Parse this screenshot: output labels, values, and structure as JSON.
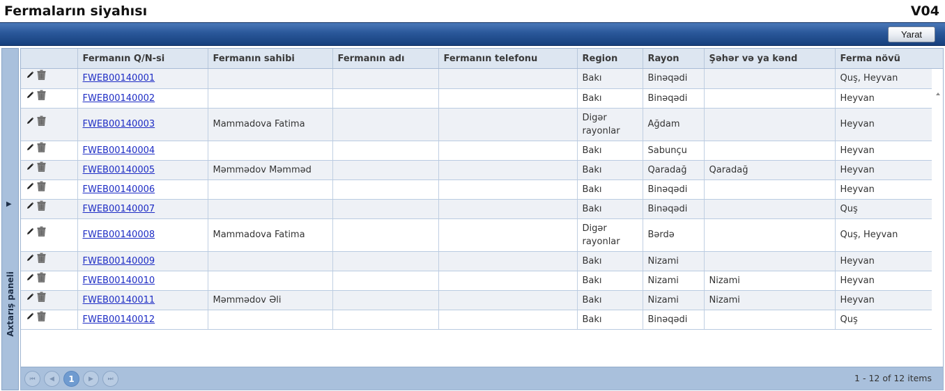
{
  "page": {
    "title": "Fermaların siyahısı",
    "code": "V04"
  },
  "toolbar": {
    "create_label": "Yarat"
  },
  "side_panel": {
    "label": "Axtarış paneli"
  },
  "grid": {
    "columns": [
      "",
      "Fermanın Q/N-si",
      "Fermanın sahibi",
      "Fermanın adı",
      "Fermanın telefonu",
      "Region",
      "Rayon",
      "Şəhər və ya kənd",
      "Ferma növü"
    ],
    "rows": [
      {
        "qn": "FWEB00140001",
        "owner": "",
        "name": "",
        "phone": "",
        "region": "Bakı",
        "rayon": "Binəqədi",
        "settlement": "",
        "type": "Quş, Heyvan"
      },
      {
        "qn": "FWEB00140002",
        "owner": "",
        "name": "",
        "phone": "",
        "region": "Bakı",
        "rayon": "Binəqədi",
        "settlement": "",
        "type": "Heyvan"
      },
      {
        "qn": "FWEB00140003",
        "owner": "Mammadova Fatima",
        "name": "",
        "phone": "",
        "region": "Digər rayonlar",
        "rayon": "Ağdam",
        "settlement": "",
        "type": "Heyvan"
      },
      {
        "qn": "FWEB00140004",
        "owner": "",
        "name": "",
        "phone": "",
        "region": "Bakı",
        "rayon": "Sabunçu",
        "settlement": "",
        "type": "Heyvan"
      },
      {
        "qn": "FWEB00140005",
        "owner": "Məmmədov Məmməd",
        "name": "",
        "phone": "",
        "region": "Bakı",
        "rayon": "Qaradağ",
        "settlement": "Qaradağ",
        "type": "Heyvan"
      },
      {
        "qn": "FWEB00140006",
        "owner": "",
        "name": "",
        "phone": "",
        "region": "Bakı",
        "rayon": "Binəqədi",
        "settlement": "",
        "type": "Heyvan"
      },
      {
        "qn": "FWEB00140007",
        "owner": "",
        "name": "",
        "phone": "",
        "region": "Bakı",
        "rayon": "Binəqədi",
        "settlement": "",
        "type": "Quş"
      },
      {
        "qn": "FWEB00140008",
        "owner": "Mammadova Fatima",
        "name": "",
        "phone": "",
        "region": "Digər rayonlar",
        "rayon": "Bərdə",
        "settlement": "",
        "type": "Quş, Heyvan"
      },
      {
        "qn": "FWEB00140009",
        "owner": "",
        "name": "",
        "phone": "",
        "region": "Bakı",
        "rayon": "Nizami",
        "settlement": "",
        "type": "Heyvan"
      },
      {
        "qn": "FWEB00140010",
        "owner": "",
        "name": "",
        "phone": "",
        "region": "Bakı",
        "rayon": "Nizami",
        "settlement": "Nizami",
        "type": "Heyvan"
      },
      {
        "qn": "FWEB00140011",
        "owner": "Məmmədov Əli",
        "name": "",
        "phone": "",
        "region": "Bakı",
        "rayon": "Nizami",
        "settlement": "Nizami",
        "type": "Heyvan"
      },
      {
        "qn": "FWEB00140012",
        "owner": "",
        "name": "",
        "phone": "",
        "region": "Bakı",
        "rayon": "Binəqədi",
        "settlement": "",
        "type": "Quş"
      }
    ],
    "row_icons": [
      "edit-icon",
      "delete-icon"
    ]
  },
  "pager": {
    "current_page": "1",
    "info": "1 - 12 of 12 items",
    "buttons": [
      "first-page-icon",
      "prev-page-icon",
      "next-page-icon",
      "last-page-icon"
    ]
  },
  "colors": {
    "toolbar": "#2a5799",
    "panel": "#a9c0dc",
    "header": "#dde6f1",
    "alt_row": "#eef1f6",
    "link": "#1d2cc4",
    "current_page": "#6f9bd0"
  }
}
